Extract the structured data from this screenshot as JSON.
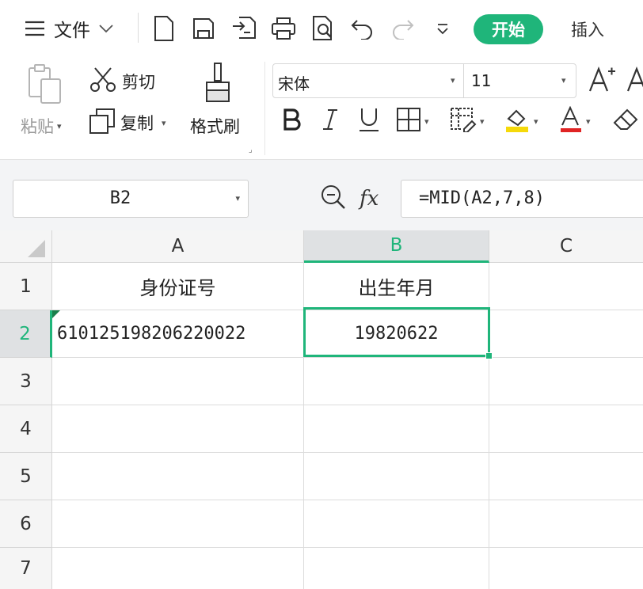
{
  "menubar": {
    "file_label": "文件",
    "tab_start": "开始",
    "tab_insert": "插入"
  },
  "ribbon": {
    "paste_label": "粘贴",
    "cut_label": "剪切",
    "copy_label": "复制",
    "format_painter_label": "格式刷",
    "font_name": "宋体",
    "font_size": "11"
  },
  "formula_bar": {
    "name_box": "B2",
    "fx_label": "fx",
    "formula": "=MID(A2,7,8)"
  },
  "grid": {
    "columns": [
      "A",
      "B",
      "C"
    ],
    "rows": [
      "1",
      "2",
      "3",
      "4",
      "5",
      "6",
      "7"
    ],
    "cells": {
      "A1": "身份证号",
      "B1": "出生年月",
      "A2": "610125198206220022",
      "B2": "19820622"
    },
    "active_cell": "B2"
  },
  "colors": {
    "accent": "#1fb57a",
    "fill_highlight": "#f5d90a",
    "font_color": "#e02424"
  }
}
